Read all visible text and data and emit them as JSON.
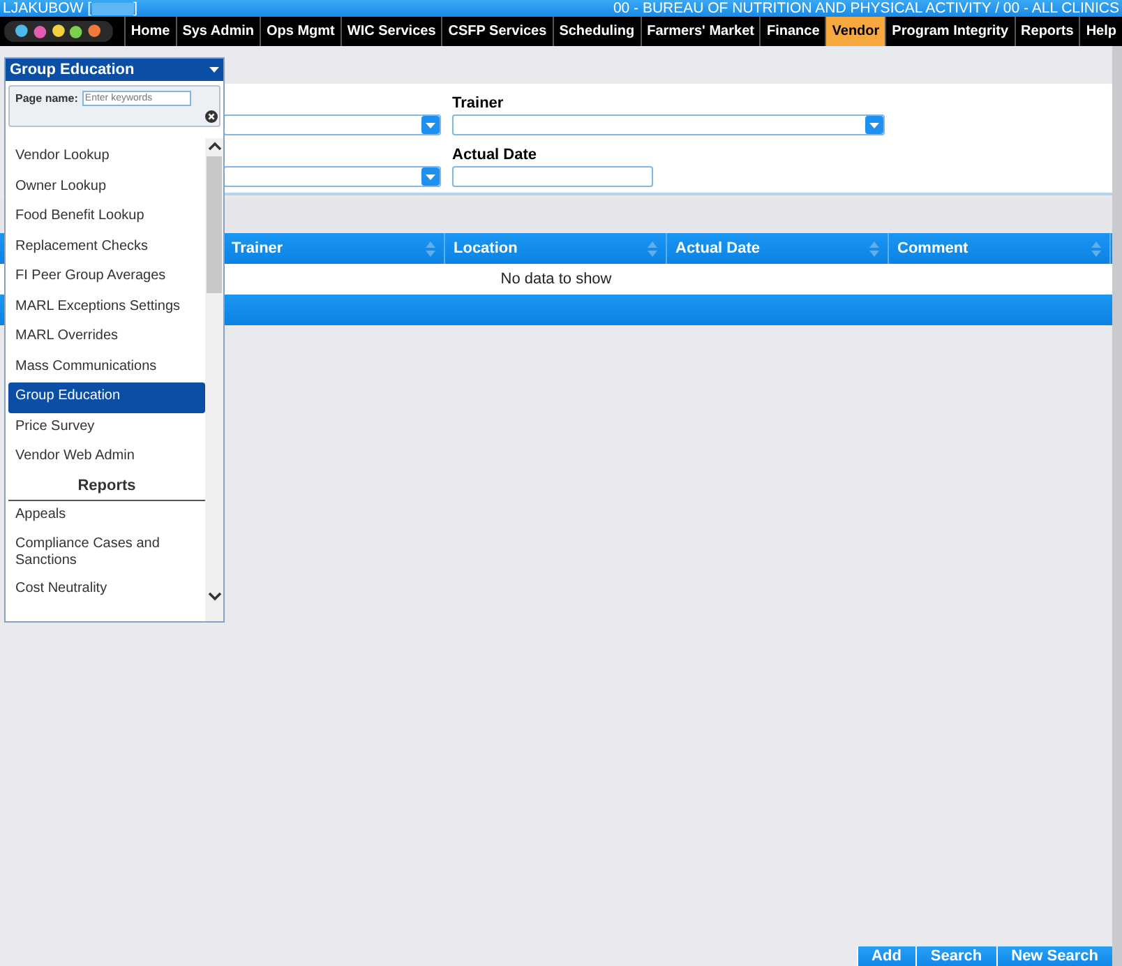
{
  "header": {
    "user": "LJAKUBOW [",
    "user_end": "]",
    "agency": "00 - BUREAU OF NUTRITION AND PHYSICAL ACTIVITY / 00 - ALL CLINICS"
  },
  "nav": [
    {
      "label": "Home",
      "selected": false
    },
    {
      "label": "Sys Admin",
      "selected": false
    },
    {
      "label": "Ops Mgmt",
      "selected": false
    },
    {
      "label": "WIC Services",
      "selected": false
    },
    {
      "label": "CSFP Services",
      "selected": false
    },
    {
      "label": "Scheduling",
      "selected": false
    },
    {
      "label": "Farmers' Market",
      "selected": false
    },
    {
      "label": "Finance",
      "selected": false
    },
    {
      "label": "Vendor",
      "selected": true
    },
    {
      "label": "Program Integrity",
      "selected": false
    },
    {
      "label": "Reports",
      "selected": false
    },
    {
      "label": "Help",
      "selected": false
    }
  ],
  "filters": [
    {
      "kind": "select"
    },
    {
      "kind": "select",
      "label": "Trainer"
    },
    {
      "kind": "select"
    },
    {
      "kind": "text",
      "label": "Actual Date"
    }
  ],
  "grid": {
    "columns": [
      "Trainer",
      "Location",
      "Actual Date",
      "Comment"
    ],
    "empty_message": "No data to show"
  },
  "buttons": [
    "Add",
    "Search",
    "New Search"
  ],
  "menu": {
    "title": "Group Education",
    "search_label": "Page name:",
    "search_placeholder": "Enter keywords",
    "items": [
      {
        "kind": "item",
        "label": "Vendor Lookup",
        "selected": false
      },
      {
        "kind": "item",
        "label": "Owner Lookup",
        "selected": false
      },
      {
        "kind": "item",
        "label": "Food Benefit Lookup",
        "selected": false
      },
      {
        "kind": "item",
        "label": "Replacement Checks",
        "selected": false
      },
      {
        "kind": "item",
        "label": "FI Peer Group Averages",
        "selected": false
      },
      {
        "kind": "item",
        "label": "MARL Exceptions Settings",
        "selected": false
      },
      {
        "kind": "item",
        "label": "MARL Overrides",
        "selected": false
      },
      {
        "kind": "item",
        "label": "Mass Communications",
        "selected": false
      },
      {
        "kind": "item",
        "label": "Group Education",
        "selected": true
      },
      {
        "kind": "item",
        "label": "Price Survey",
        "selected": false
      },
      {
        "kind": "item",
        "label": "Vendor Web Admin",
        "selected": false
      },
      {
        "kind": "heading",
        "label": "Reports"
      },
      {
        "kind": "item",
        "label": "Appeals",
        "selected": false
      },
      {
        "kind": "item",
        "label": "Compliance Cases and Sanctions",
        "selected": false
      },
      {
        "kind": "item",
        "label": "Cost Neutrality",
        "selected": false
      }
    ]
  }
}
